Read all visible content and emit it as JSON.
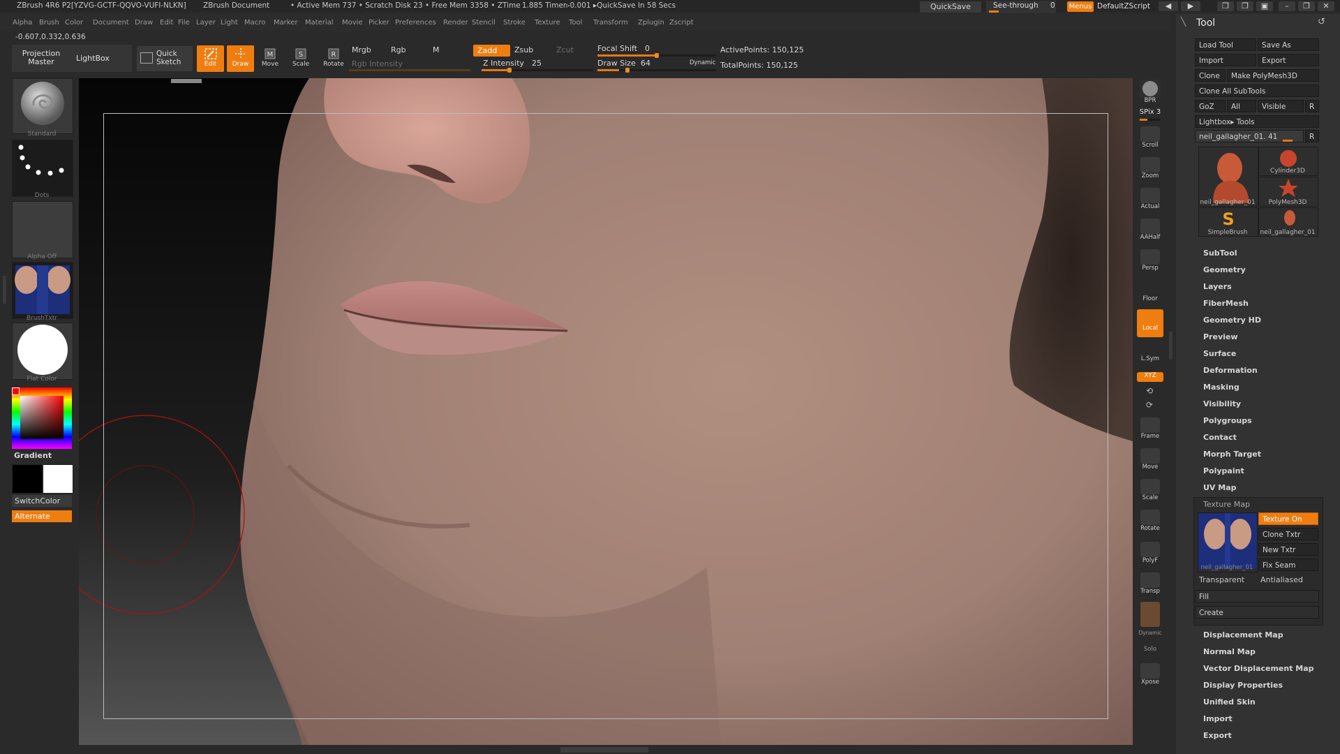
{
  "titlebar": {
    "app": "ZBrush 4R6 P2[YZVG-GCTF-QQVO-VUFI-NLKN]",
    "document": "ZBrush Document",
    "status": "• Active Mem 737 • Scratch Disk 23 • Free Mem 3358 • ZTime 1.885 Timer▹0.001 ▸QuickSave In 58 Secs",
    "quicksave": "QuickSave",
    "see_through": "See-through",
    "see_through_value": "0",
    "menus": "Menus",
    "default_zscript": "DefaultZScript"
  },
  "menubar": [
    "Alpha",
    "Brush",
    "Color",
    "Document",
    "Draw",
    "Edit",
    "File",
    "Layer",
    "Light",
    "Macro",
    "Marker",
    "Material",
    "Movie",
    "Picker",
    "Preferences",
    "Render",
    "Stencil",
    "Stroke",
    "Texture",
    "Tool",
    "Transform",
    "Zplugin",
    "Zscript"
  ],
  "coords": "-0.607,0.332,0.636",
  "toolbar": {
    "projection_master": "Projection Master",
    "lightbox": "LightBox",
    "quick_sketch": "Quick Sketch",
    "edit": "Edit",
    "draw": "Draw",
    "move": "Move",
    "scale": "Scale",
    "rotate": "Rotate",
    "mrgb": "Mrgb",
    "rgb": "Rgb",
    "m": "M",
    "rgb_intensity": "Rgb Intensity",
    "zadd": "Zadd",
    "zsub": "Zsub",
    "zcut": "Zcut",
    "z_intensity_label": "Z Intensity",
    "z_intensity": "25",
    "focal_shift_label": "Focal Shift",
    "focal_shift": "0",
    "draw_size_label": "Draw Size",
    "draw_size": "64",
    "dynamic": "Dynamic",
    "active_points": "ActivePoints: 150,125",
    "total_points": "TotalPoints: 150,125"
  },
  "left_shelf": {
    "brush": "Standard",
    "stroke": "Dots",
    "alpha": "Alpha Off",
    "texture": "BrushTxtr",
    "material": "Flat Color",
    "gradient": "Gradient",
    "switch_color": "SwitchColor",
    "alternate": "Alternate"
  },
  "right_shelf": [
    "BPR",
    "SPix 3",
    "Scroll",
    "Zoom",
    "Actual",
    "AAHalf",
    "Persp",
    "Floor",
    "Local",
    "L.Sym",
    "XYZ",
    "Frame",
    "Move",
    "Scale",
    "Rotate",
    "PolyF",
    "Transp",
    "Dynamic",
    "Solo",
    "Xpose"
  ],
  "tool_panel": {
    "title": "Tool",
    "load_tool": "Load Tool",
    "save_as": "Save As",
    "import": "Import",
    "export": "Export",
    "clone": "Clone",
    "make_polymesh": "Make PolyMesh3D",
    "clone_all_subtools": "Clone All SubTools",
    "goz": "GoZ",
    "all": "All",
    "visible": "Visible",
    "r": "R",
    "lightbox_tools": "Lightbox▸ Tools",
    "current_tool": "neil_gallagher_01. 41",
    "thumbs": [
      "neil_gallagher_01",
      "Cylinder3D",
      "PolyMesh3D",
      "SimpleBrush",
      "neil_gallagher_01"
    ],
    "sections_top": [
      "SubTool",
      "Geometry",
      "Layers",
      "FiberMesh",
      "Geometry HD",
      "Preview",
      "Surface",
      "Deformation",
      "Masking",
      "Visibility",
      "Polygroups",
      "Contact",
      "Morph Target",
      "Polypaint",
      "UV Map"
    ],
    "texture_map": {
      "title": "Texture Map",
      "texture_on": "Texture On",
      "clone_txtr": "Clone Txtr",
      "new_txtr": "New Txtr",
      "fix_seam": "Fix Seam",
      "thumb_caption": "neil_gallagher_01",
      "transparent": "Transparent",
      "antialiased": "Antialiased",
      "fill": "Fill",
      "create": "Create"
    },
    "sections_bottom": [
      "Displacement Map",
      "Normal Map",
      "Vector Displacement Map",
      "Display Properties",
      "Unified Skin",
      "Import",
      "Export"
    ]
  }
}
